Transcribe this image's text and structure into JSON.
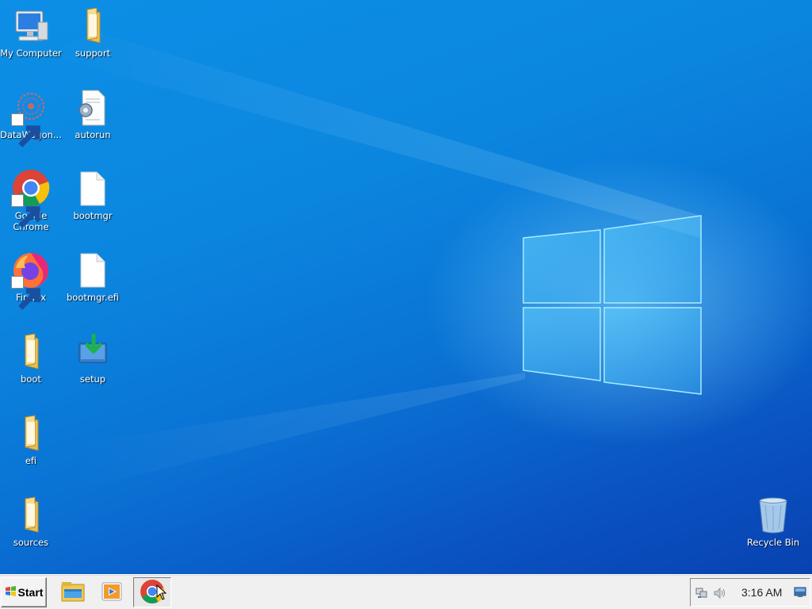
{
  "desktop": {
    "icons": {
      "my_computer": "My Computer",
      "support": "support",
      "datawagon": "DataWagon...",
      "autorun": "autorun",
      "chrome_line1": "Google",
      "chrome_line2": "Chrome",
      "bootmgr": "bootmgr",
      "firefox": "Firefox",
      "bootmgr_efi": "bootmgr.efi",
      "boot": "boot",
      "setup": "setup",
      "efi": "efi",
      "sources": "sources",
      "recycle_bin": "Recycle Bin"
    }
  },
  "taskbar": {
    "start_label": "Start",
    "items": [
      "file-explorer-icon",
      "media-player-icon",
      "chrome-icon"
    ],
    "active_item": "chrome-icon",
    "clock": "3:16 AM",
    "tray_icons": [
      "network-icon",
      "volume-icon",
      "desktop-icon"
    ]
  },
  "colors": {
    "wallpaper_blue": "#0a78d8",
    "taskbar": "#f0f0f0",
    "chrome_red": "#db4437",
    "chrome_yellow": "#f4c20d",
    "chrome_green": "#0f9d58",
    "chrome_blue": "#4285f4",
    "folder": "#f4d27a"
  }
}
